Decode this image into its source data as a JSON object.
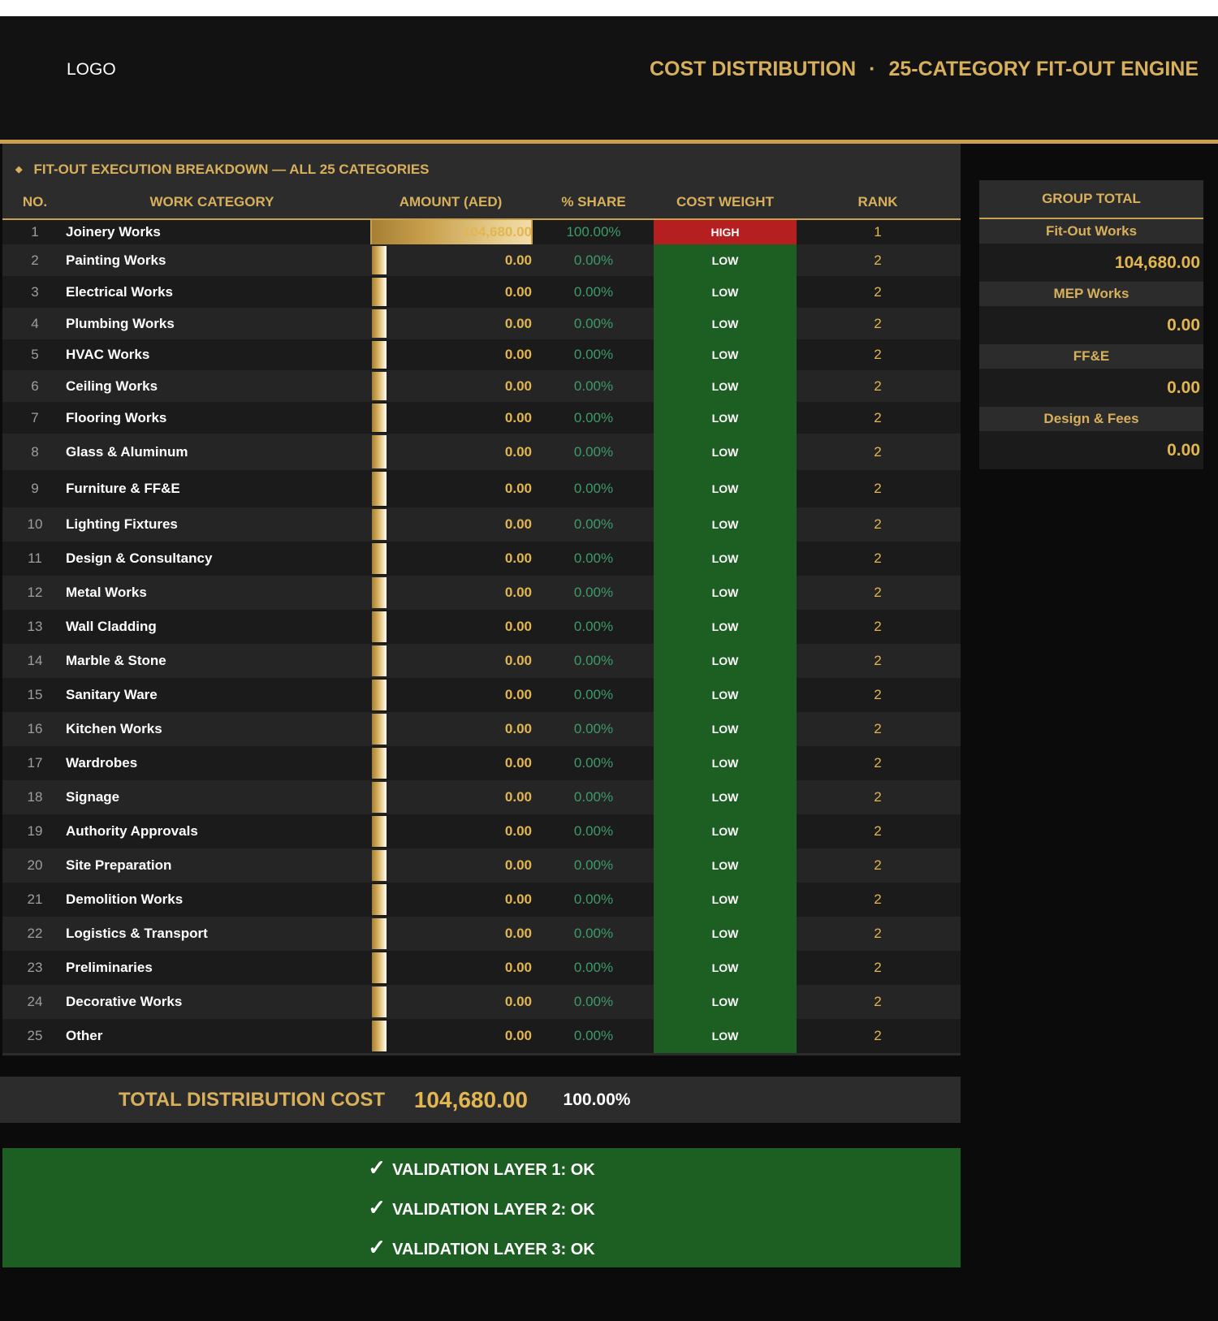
{
  "header": {
    "logo": "LOGO",
    "title_left": "COST DISTRIBUTION",
    "title_sep": "·",
    "title_right": "25-CATEGORY FIT-OUT ENGINE"
  },
  "section": {
    "bullet": "◆",
    "title": "FIT-OUT EXECUTION BREAKDOWN — ALL 25 CATEGORIES"
  },
  "table": {
    "columns": {
      "no": "NO.",
      "category": "WORK CATEGORY",
      "amount": "AMOUNT (AED)",
      "share": "% SHARE",
      "weight": "COST WEIGHT",
      "rank": "RANK"
    },
    "rows": [
      {
        "no": "1",
        "category": "Joinery Works",
        "amount": "104,680.00",
        "share": "100.00%",
        "weight": "HIGH",
        "rank": "1",
        "bar_fraction": 1.0
      },
      {
        "no": "2",
        "category": "Painting Works",
        "amount": "0.00",
        "share": "0.00%",
        "weight": "LOW",
        "rank": "2",
        "bar_fraction": 0
      },
      {
        "no": "3",
        "category": "Electrical Works",
        "amount": "0.00",
        "share": "0.00%",
        "weight": "LOW",
        "rank": "2",
        "bar_fraction": 0
      },
      {
        "no": "4",
        "category": "Plumbing Works",
        "amount": "0.00",
        "share": "0.00%",
        "weight": "LOW",
        "rank": "2",
        "bar_fraction": 0
      },
      {
        "no": "5",
        "category": "HVAC Works",
        "amount": "0.00",
        "share": "0.00%",
        "weight": "LOW",
        "rank": "2",
        "bar_fraction": 0
      },
      {
        "no": "6",
        "category": "Ceiling Works",
        "amount": "0.00",
        "share": "0.00%",
        "weight": "LOW",
        "rank": "2",
        "bar_fraction": 0
      },
      {
        "no": "7",
        "category": "Flooring Works",
        "amount": "0.00",
        "share": "0.00%",
        "weight": "LOW",
        "rank": "2",
        "bar_fraction": 0
      },
      {
        "no": "8",
        "category": "Glass & Aluminum",
        "amount": "0.00",
        "share": "0.00%",
        "weight": "LOW",
        "rank": "2",
        "bar_fraction": 0
      },
      {
        "no": "9",
        "category": "Furniture & FF&E",
        "amount": "0.00",
        "share": "0.00%",
        "weight": "LOW",
        "rank": "2",
        "bar_fraction": 0
      },
      {
        "no": "10",
        "category": "Lighting Fixtures",
        "amount": "0.00",
        "share": "0.00%",
        "weight": "LOW",
        "rank": "2",
        "bar_fraction": 0
      },
      {
        "no": "11",
        "category": "Design & Consultancy",
        "amount": "0.00",
        "share": "0.00%",
        "weight": "LOW",
        "rank": "2",
        "bar_fraction": 0
      },
      {
        "no": "12",
        "category": "Metal Works",
        "amount": "0.00",
        "share": "0.00%",
        "weight": "LOW",
        "rank": "2",
        "bar_fraction": 0
      },
      {
        "no": "13",
        "category": "Wall Cladding",
        "amount": "0.00",
        "share": "0.00%",
        "weight": "LOW",
        "rank": "2",
        "bar_fraction": 0
      },
      {
        "no": "14",
        "category": "Marble & Stone",
        "amount": "0.00",
        "share": "0.00%",
        "weight": "LOW",
        "rank": "2",
        "bar_fraction": 0
      },
      {
        "no": "15",
        "category": "Sanitary Ware",
        "amount": "0.00",
        "share": "0.00%",
        "weight": "LOW",
        "rank": "2",
        "bar_fraction": 0
      },
      {
        "no": "16",
        "category": "Kitchen Works",
        "amount": "0.00",
        "share": "0.00%",
        "weight": "LOW",
        "rank": "2",
        "bar_fraction": 0
      },
      {
        "no": "17",
        "category": "Wardrobes",
        "amount": "0.00",
        "share": "0.00%",
        "weight": "LOW",
        "rank": "2",
        "bar_fraction": 0
      },
      {
        "no": "18",
        "category": "Signage",
        "amount": "0.00",
        "share": "0.00%",
        "weight": "LOW",
        "rank": "2",
        "bar_fraction": 0
      },
      {
        "no": "19",
        "category": "Authority Approvals",
        "amount": "0.00",
        "share": "0.00%",
        "weight": "LOW",
        "rank": "2",
        "bar_fraction": 0
      },
      {
        "no": "20",
        "category": "Site Preparation",
        "amount": "0.00",
        "share": "0.00%",
        "weight": "LOW",
        "rank": "2",
        "bar_fraction": 0
      },
      {
        "no": "21",
        "category": "Demolition Works",
        "amount": "0.00",
        "share": "0.00%",
        "weight": "LOW",
        "rank": "2",
        "bar_fraction": 0
      },
      {
        "no": "22",
        "category": "Logistics & Transport",
        "amount": "0.00",
        "share": "0.00%",
        "weight": "LOW",
        "rank": "2",
        "bar_fraction": 0
      },
      {
        "no": "23",
        "category": "Preliminaries",
        "amount": "0.00",
        "share": "0.00%",
        "weight": "LOW",
        "rank": "2",
        "bar_fraction": 0
      },
      {
        "no": "24",
        "category": "Decorative Works",
        "amount": "0.00",
        "share": "0.00%",
        "weight": "LOW",
        "rank": "2",
        "bar_fraction": 0
      },
      {
        "no": "25",
        "category": "Other",
        "amount": "0.00",
        "share": "0.00%",
        "weight": "LOW",
        "rank": "2",
        "bar_fraction": 0
      }
    ]
  },
  "total": {
    "label": "TOTAL DISTRIBUTION COST",
    "amount": "104,680.00",
    "share": "100.00%"
  },
  "validation": [
    {
      "check": "✓",
      "text": "VALIDATION LAYER 1: OK"
    },
    {
      "check": "✓",
      "text": "VALIDATION LAYER 2: OK"
    },
    {
      "check": "✓",
      "text": "VALIDATION LAYER 3: OK"
    }
  ],
  "group_total": {
    "header": "GROUP TOTAL",
    "groups": [
      {
        "label": "Fit-Out Works",
        "value": "104,680.00"
      },
      {
        "label": "MEP Works",
        "value": "0.00"
      },
      {
        "label": "FF&E",
        "value": "0.00"
      },
      {
        "label": "Design & Fees",
        "value": "0.00"
      }
    ]
  },
  "colors": {
    "gold": "#d8b05c",
    "high": "#b61f1f",
    "low": "#1d5f22",
    "share_text": "#3d9c68"
  }
}
